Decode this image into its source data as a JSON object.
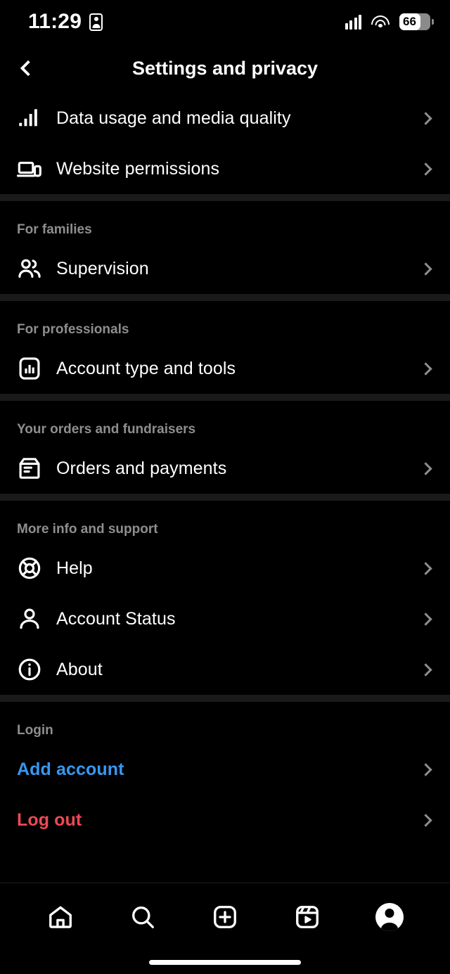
{
  "statusbar": {
    "time": "11:29",
    "badge_icon": "id-badge-icon",
    "signal_icon": "cellular-signal-icon",
    "wifi_icon": "wifi-icon",
    "battery_level": "66",
    "battery_icon": "battery-icon"
  },
  "header": {
    "title": "Settings and privacy",
    "back_icon": "back-chevron-icon"
  },
  "sections": [
    {
      "title": null,
      "items": [
        {
          "label": "Data usage and media quality",
          "icon": "signal-bars-icon",
          "style": "default"
        },
        {
          "label": "Website permissions",
          "icon": "devices-icon",
          "style": "default"
        }
      ]
    },
    {
      "title": "For families",
      "items": [
        {
          "label": "Supervision",
          "icon": "people-icon",
          "style": "default"
        }
      ]
    },
    {
      "title": "For professionals",
      "items": [
        {
          "label": "Account type and tools",
          "icon": "chart-square-icon",
          "style": "default"
        }
      ]
    },
    {
      "title": "Your orders and fundraisers",
      "items": [
        {
          "label": "Orders and payments",
          "icon": "box-receipt-icon",
          "style": "default"
        }
      ]
    },
    {
      "title": "More info and support",
      "items": [
        {
          "label": "Help",
          "icon": "lifebuoy-icon",
          "style": "default"
        },
        {
          "label": "Account Status",
          "icon": "person-icon",
          "style": "default"
        },
        {
          "label": "About",
          "icon": "info-circle-icon",
          "style": "default"
        }
      ]
    },
    {
      "title": "Login",
      "items": [
        {
          "label": "Add account",
          "icon": null,
          "style": "blue"
        },
        {
          "label": "Log out",
          "icon": null,
          "style": "red"
        }
      ]
    }
  ],
  "colors": {
    "background": "#000000",
    "separator": "#1a1a1a",
    "section_title": "#8e8e8e",
    "chevron": "#8e8e8e",
    "add_account": "#3797f0",
    "log_out": "#ed4956"
  },
  "bottom_nav": [
    {
      "name": "home",
      "icon": "home-icon"
    },
    {
      "name": "search",
      "icon": "search-icon"
    },
    {
      "name": "create",
      "icon": "plus-square-icon"
    },
    {
      "name": "reels",
      "icon": "reels-icon"
    },
    {
      "name": "profile",
      "icon": "avatar-icon"
    }
  ]
}
